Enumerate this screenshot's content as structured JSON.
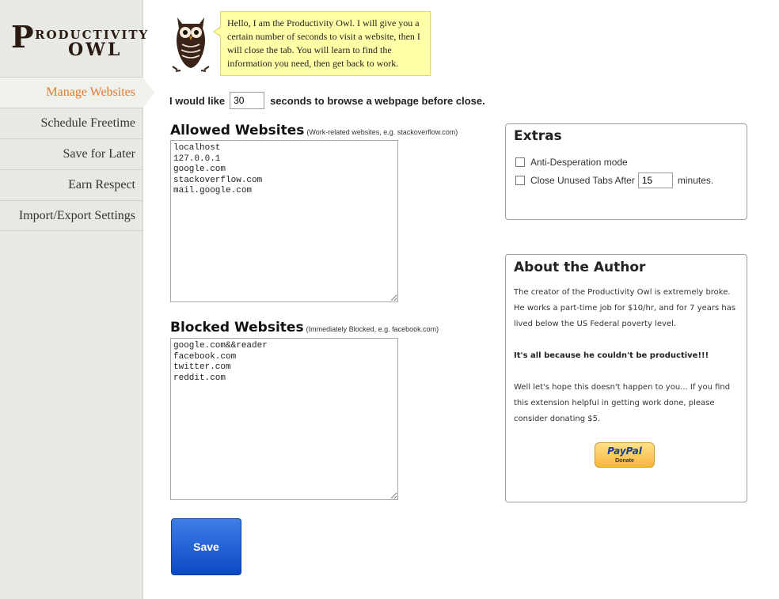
{
  "logo": {
    "p": "P",
    "roductivity": "RODUCTIVITY",
    "owl": "OWL"
  },
  "sidebar": {
    "items": [
      {
        "label": "Manage Websites"
      },
      {
        "label": "Schedule Freetime"
      },
      {
        "label": "Save for Later"
      },
      {
        "label": "Earn Respect"
      },
      {
        "label": "Import/Export Settings"
      }
    ]
  },
  "owl": {
    "icon": "owl-icon",
    "message": "Hello, I am the Productivity Owl. I will give you a certain number of seconds to visit a website, then I will close the tab. You will learn to find the information you need, then get back to work."
  },
  "seconds": {
    "prefix": "I would like",
    "value": "30",
    "suffix": "seconds to browse a webpage before close."
  },
  "allowed": {
    "title": "Allowed Websites",
    "subtitle": "(Work-related websites, e.g. stackoverflow.com)",
    "value": "localhost\n127.0.0.1\ngoogle.com\nstackoverflow.com\nmail.google.com"
  },
  "blocked": {
    "title": "Blocked Websites",
    "subtitle": "(Immediately Blocked, e.g. facebook.com)",
    "value": "google.com&&reader\nfacebook.com\ntwitter.com\nreddit.com"
  },
  "extras": {
    "title": "Extras",
    "anti_desperation": "Anti-Desperation mode",
    "close_prefix": "Close Unused Tabs After",
    "close_value": "15",
    "close_suffix": "minutes."
  },
  "author": {
    "title": "About the Author",
    "p1": "The creator of the Productivity Owl is extremely broke. He works a part-time job for $10/hr, and for 7 years has lived below the US Federal poverty level.",
    "p2": "It's all because he couldn't be productive!!!",
    "p3": "Well let's hope this doesn't happen to you... If you find this extension helpful in getting work done, please consider donating $5.",
    "paypal": "PayPal",
    "donate": "Donate"
  },
  "save_label": "Save",
  "colors": {
    "active_nav": "#e07a2e",
    "bubble": "#ffffa8",
    "save_button": "#1659d4"
  }
}
